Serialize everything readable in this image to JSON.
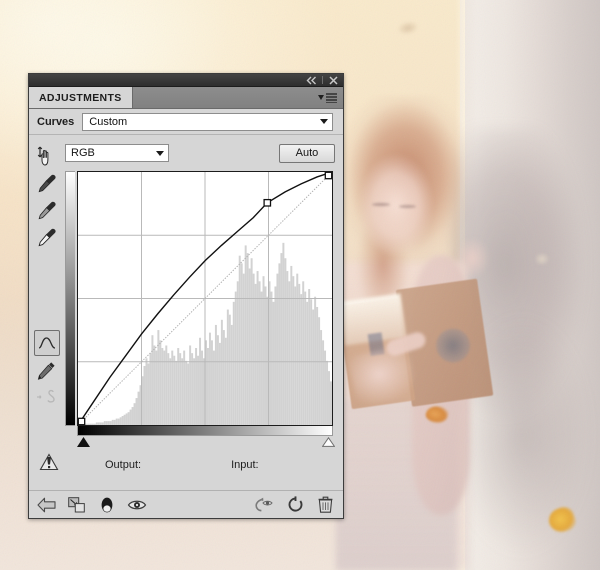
{
  "panel": {
    "tab_label": "ADJUSTMENTS",
    "titlebar": {
      "collapse_icon": "double-chevron-left-icon",
      "close_icon": "close-icon",
      "menu_icon": "panel-menu-icon"
    },
    "adjustment_name": "Curves",
    "preset": {
      "value": "Custom",
      "placeholder": "Custom",
      "caret_icon": "chevron-down-icon"
    },
    "channel": {
      "value": "RGB",
      "caret_icon": "chevron-down-icon"
    },
    "auto_label": "Auto",
    "tools": [
      {
        "name": "targeted-adjustment-tool",
        "icon": "hand-arrows-icon",
        "state": "normal"
      },
      {
        "name": "black-point-eyedropper",
        "icon": "eyedropper-black-icon",
        "state": "normal"
      },
      {
        "name": "gray-point-eyedropper",
        "icon": "eyedropper-gray-icon",
        "state": "normal"
      },
      {
        "name": "white-point-eyedropper",
        "icon": "eyedropper-white-icon",
        "state": "normal"
      },
      {
        "name": "edit-points-curve-tool",
        "icon": "curve-icon",
        "state": "selected"
      },
      {
        "name": "pencil-draw-curve-tool",
        "icon": "pencil-icon",
        "state": "normal"
      },
      {
        "name": "smooth-curve-button",
        "icon": "smooth-curve-icon",
        "state": "disabled"
      }
    ],
    "fields": {
      "output_label": "Output:",
      "output_value": "",
      "input_label": "Input:",
      "input_value": ""
    },
    "sliders": {
      "black_point_icon": "black-triangle-slider",
      "white_point_icon": "white-triangle-slider",
      "black_point_position_pct": 0,
      "white_point_position_pct": 100
    },
    "clipping_warning_icon": "clipping-warning-icon",
    "bottom_bar": [
      {
        "name": "return-to-adjustment-list-button",
        "icon": "back-arrow-icon"
      },
      {
        "name": "clip-to-layer-button",
        "icon": "clip-to-layer-icon"
      },
      {
        "name": "toggle-layer-mask-button",
        "icon": "mask-ellipse-icon"
      },
      {
        "name": "toggle-layer-visibility-button",
        "icon": "eye-icon"
      },
      {
        "name": "preview-previous-state-button",
        "icon": "preview-previous-icon"
      },
      {
        "name": "reset-adjustment-button",
        "icon": "reset-circular-arrow-icon"
      },
      {
        "name": "delete-adjustment-layer-button",
        "icon": "trash-icon"
      }
    ]
  },
  "colors": {
    "panel_bg": "#d6d6d6",
    "titlebar_bg": "#343434",
    "tabbar_bg": "#858585",
    "graph_bg": "#ffffff",
    "grid_line": "#b9b9b9",
    "curve_line": "#111111",
    "baseline": "#b0b0b0",
    "histogram": "#d2d2d2",
    "field_bg": "#ffffff"
  },
  "chart_data": {
    "type": "line",
    "title": "RGB Curve",
    "xlabel": "Input",
    "ylabel": "Output",
    "xlim": [
      0,
      255
    ],
    "ylim": [
      0,
      255
    ],
    "grid": true,
    "grid_divisions": 4,
    "series": [
      {
        "name": "baseline-identity",
        "style": "dotted-diagonal",
        "x": [
          0,
          255
        ],
        "y": [
          0,
          255
        ]
      },
      {
        "name": "rgb-curve",
        "style": "solid",
        "control_points": [
          {
            "input": 0,
            "output": 0
          },
          {
            "input": 190,
            "output": 224
          },
          {
            "input": 255,
            "output": 255
          }
        ],
        "x": [
          0,
          16,
          32,
          48,
          64,
          80,
          96,
          112,
          128,
          144,
          160,
          176,
          190,
          208,
          224,
          240,
          255
        ],
        "y": [
          0,
          24,
          48,
          70,
          92,
          112,
          131,
          149,
          166,
          181,
          195,
          209,
          224,
          235,
          243,
          250,
          255
        ]
      }
    ],
    "histogram": {
      "name": "rgb-histogram",
      "bins": 128,
      "values": [
        1,
        1,
        1,
        1,
        1,
        1,
        1,
        1,
        1,
        2,
        2,
        2,
        2,
        3,
        3,
        3,
        3,
        4,
        4,
        5,
        5,
        6,
        7,
        8,
        9,
        10,
        12,
        14,
        17,
        21,
        26,
        31,
        38,
        46,
        52,
        48,
        56,
        70,
        62,
        58,
        74,
        66,
        60,
        58,
        62,
        56,
        52,
        58,
        54,
        50,
        60,
        56,
        52,
        58,
        50,
        48,
        62,
        56,
        52,
        60,
        54,
        68,
        58,
        52,
        66,
        60,
        72,
        66,
        58,
        78,
        70,
        64,
        82,
        74,
        68,
        90,
        86,
        78,
        96,
        104,
        112,
        132,
        126,
        118,
        140,
        134,
        122,
        130,
        118,
        110,
        120,
        112,
        104,
        116,
        108,
        100,
        112,
        104,
        96,
        108,
        118,
        126,
        134,
        142,
        130,
        120,
        112,
        124,
        116,
        108,
        118,
        110,
        102,
        112,
        104,
        96,
        106,
        98,
        90,
        100,
        92,
        84,
        74,
        66,
        58,
        50,
        42,
        34
      ]
    }
  }
}
